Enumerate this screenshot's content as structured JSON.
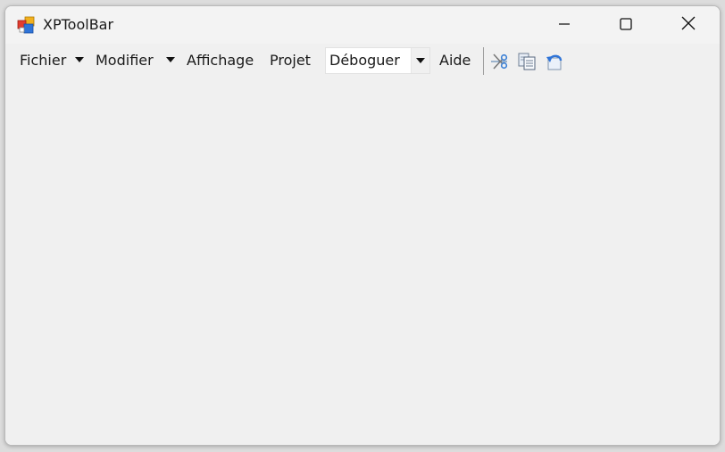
{
  "window": {
    "title": "XPToolBar"
  },
  "icons": {
    "app": "app-icon",
    "minimize": "minimize-icon",
    "maximize": "maximize-icon",
    "close": "close-icon",
    "cut": "cut-icon",
    "copy": "copy-icon",
    "undo": "undo-icon"
  },
  "toolbar": {
    "items": [
      {
        "label": "Fichier",
        "has_dropdown": true
      },
      {
        "label": "Modifier",
        "has_dropdown": true
      },
      {
        "label": "Affichage",
        "has_dropdown": false
      },
      {
        "label": "Projet",
        "has_dropdown": false
      }
    ],
    "combo": {
      "value": "Déboguer"
    },
    "help_label": "Aide"
  },
  "colors": {
    "window_bg": "#f0f0f0",
    "titlebar_bg": "#f3f3f3",
    "accent_blue": "#3a7fd5"
  }
}
